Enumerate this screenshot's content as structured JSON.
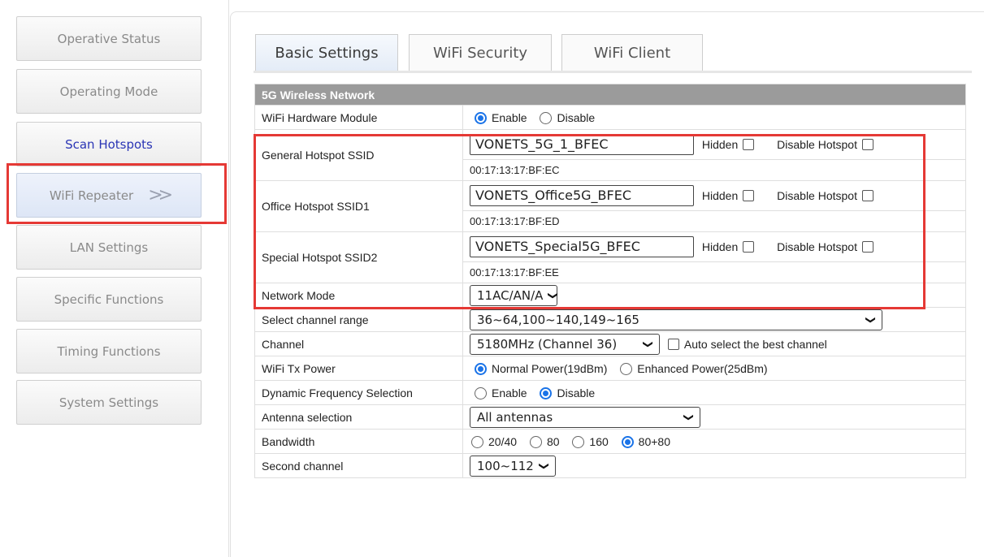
{
  "sidebar": {
    "items": [
      {
        "label": "Operative Status"
      },
      {
        "label": "Operating Mode"
      },
      {
        "label": "Scan Hotspots"
      },
      {
        "label": "WiFi Repeater"
      },
      {
        "label": "LAN Settings"
      },
      {
        "label": "Specific Functions"
      },
      {
        "label": "Timing Functions"
      },
      {
        "label": "System Settings"
      }
    ],
    "active_arrows": ">>"
  },
  "tabs": [
    {
      "label": "Basic Settings"
    },
    {
      "label": "WiFi Security"
    },
    {
      "label": "WiFi Client"
    }
  ],
  "section_title": "5G Wireless Network",
  "rows": {
    "hardware": {
      "label": "WiFi Hardware Module",
      "opt1": "Enable",
      "opt2": "Disable"
    },
    "ssid_general": {
      "label": "General Hotspot SSID",
      "value": "VONETS_5G_1_BFEC",
      "mac": "00:17:13:17:BF:EC"
    },
    "ssid_office": {
      "label": "Office Hotspot SSID1",
      "value": "VONETS_Office5G_BFEC",
      "mac": "00:17:13:17:BF:ED"
    },
    "ssid_special": {
      "label": "Special Hotspot SSID2",
      "value": "VONETS_Special5G_BFEC",
      "mac": "00:17:13:17:BF:EE"
    },
    "hidden_label": "Hidden",
    "disable_hotspot_label": "Disable Hotspot",
    "network_mode": {
      "label": "Network Mode",
      "value": "11AC/AN/A"
    },
    "channel_range": {
      "label": "Select channel range",
      "value": "36~64,100~140,149~165"
    },
    "channel": {
      "label": "Channel",
      "value": "5180MHz (Channel 36)",
      "auto_label": "Auto select the best channel"
    },
    "tx_power": {
      "label": "WiFi Tx Power",
      "opt1": "Normal Power(19dBm)",
      "opt2": "Enhanced Power(25dBm)"
    },
    "dfs": {
      "label": "Dynamic Frequency Selection",
      "opt1": "Enable",
      "opt2": "Disable"
    },
    "antenna": {
      "label": "Antenna selection",
      "value": "All antennas"
    },
    "bandwidth": {
      "label": "Bandwidth",
      "opt1": "20/40",
      "opt2": "80",
      "opt3": "160",
      "opt4": "80+80"
    },
    "second_channel": {
      "label": "Second channel",
      "value": "100~112"
    }
  },
  "colors": {
    "highlight": "#e53935",
    "radio_selected": "#1a73e8",
    "section_header": "#9b9b9b"
  }
}
